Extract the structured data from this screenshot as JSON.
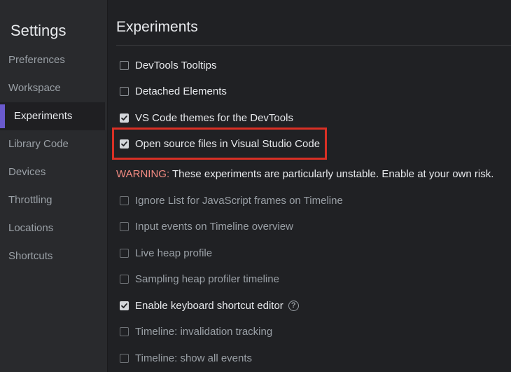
{
  "sidebar": {
    "title": "Settings",
    "items": [
      {
        "label": "Preferences"
      },
      {
        "label": "Workspace"
      },
      {
        "label": "Experiments"
      },
      {
        "label": "Library Code"
      },
      {
        "label": "Devices"
      },
      {
        "label": "Throttling"
      },
      {
        "label": "Locations"
      },
      {
        "label": "Shortcuts"
      }
    ],
    "active_index": 2
  },
  "main": {
    "title": "Experiments",
    "experiments": [
      {
        "label": "DevTools Tooltips",
        "checked": false
      },
      {
        "label": "Detached Elements",
        "checked": false
      },
      {
        "label": "VS Code themes for the DevTools",
        "checked": true
      },
      {
        "label": "Open source files in Visual Studio Code",
        "checked": true
      }
    ],
    "warning": {
      "label": "WARNING:",
      "text": " These experiments are particularly unstable. Enable at your own risk."
    },
    "unstable_experiments": [
      {
        "label": "Ignore List for JavaScript frames on Timeline",
        "checked": false
      },
      {
        "label": "Input events on Timeline overview",
        "checked": false
      },
      {
        "label": "Live heap profile",
        "checked": false
      },
      {
        "label": "Sampling heap profiler timeline",
        "checked": false
      },
      {
        "label": "Enable keyboard shortcut editor",
        "checked": true,
        "help": "?"
      },
      {
        "label": "Timeline: invalidation tracking",
        "checked": false
      },
      {
        "label": "Timeline: show all events",
        "checked": false
      }
    ]
  },
  "colors": {
    "accent": "#6a5acd",
    "highlight": "#d93025",
    "warning": "#f28b82"
  }
}
